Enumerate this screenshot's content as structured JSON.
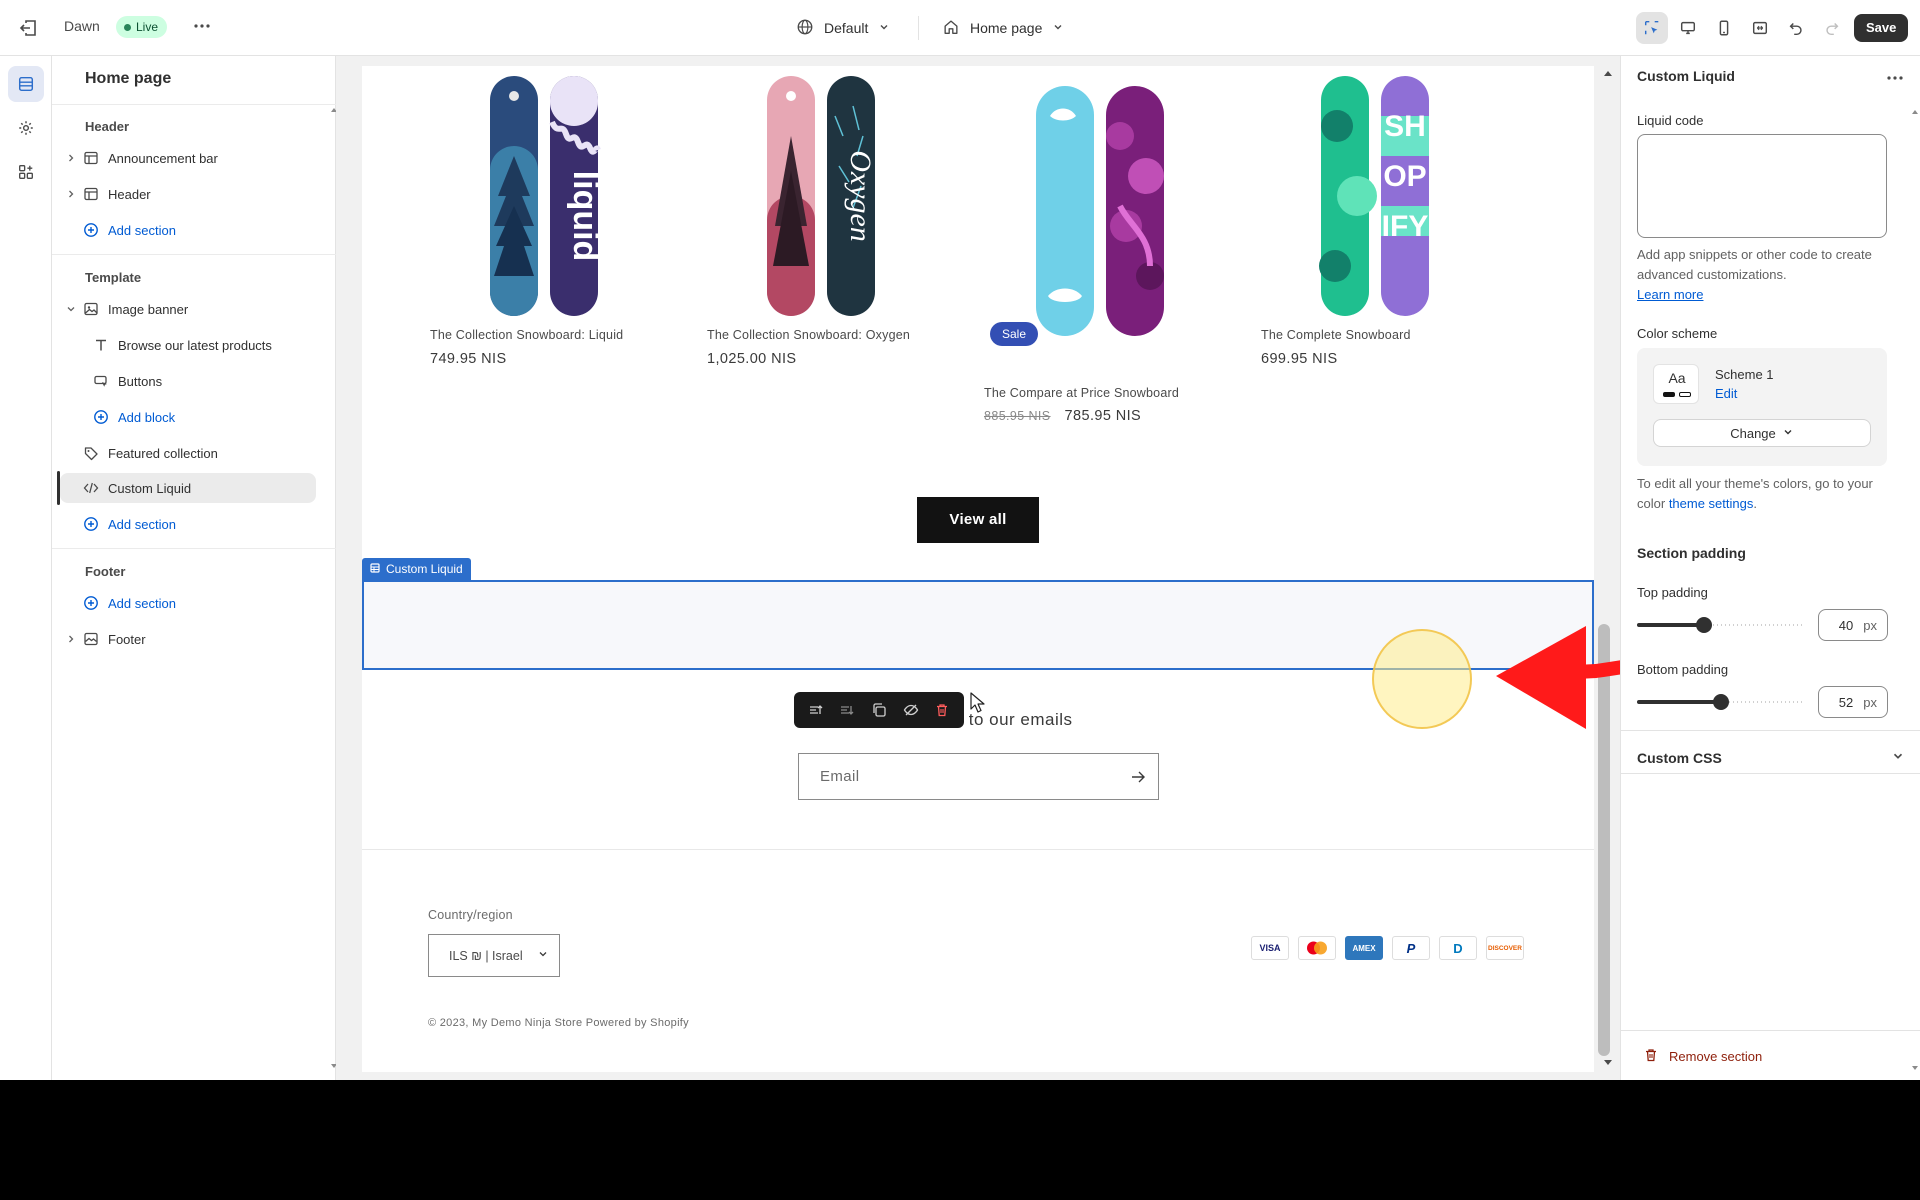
{
  "topbar": {
    "theme_name": "Dawn",
    "live_badge": "Live",
    "locale": "Default",
    "page": "Home page",
    "save_label": "Save"
  },
  "sidebar": {
    "title": "Home page",
    "header_group": "Header",
    "header_items": [
      "Announcement bar",
      "Header"
    ],
    "add_section": "Add section",
    "template_group": "Template",
    "image_banner": "Image banner",
    "image_banner_blocks": [
      "Browse our latest products",
      "Buttons"
    ],
    "add_block": "Add block",
    "featured_collection": "Featured collection",
    "custom_liquid": "Custom Liquid",
    "footer_group": "Footer",
    "footer_item": "Footer"
  },
  "preview": {
    "products": [
      {
        "name": "The Collection Snowboard: Liquid",
        "price": "749.95 NIS"
      },
      {
        "name": "The Collection Snowboard: Oxygen",
        "price": "1,025.00 NIS"
      },
      {
        "name": "The Compare at Price Snowboard",
        "compare_price": "885.95 NIS",
        "price": "785.95 NIS",
        "badge": "Sale"
      },
      {
        "name": "The Complete Snowboard",
        "price": "699.95 NIS"
      }
    ],
    "view_all": "View all",
    "section_tag": "Custom Liquid",
    "subscribe_heading": "Subscribe to our emails",
    "email_placeholder": "Email",
    "country_label": "Country/region",
    "country_value": "ILS ₪ | Israel",
    "payments": [
      "Visa",
      "Mastercard",
      "American Express",
      "PayPal",
      "Diners Club",
      "Discover"
    ],
    "payment_short": [
      "VISA",
      "MC",
      "AMEX",
      "P",
      "D",
      "DISCOVER"
    ],
    "copyright": "© 2023, My Demo Ninja Store Powered by Shopify"
  },
  "panel": {
    "title": "Custom Liquid",
    "liquid_code_label": "Liquid code",
    "liquid_help": "Add app snippets or other code to create advanced customizations.",
    "learn_more": "Learn more",
    "color_scheme_label": "Color scheme",
    "scheme_aa": "Aa",
    "scheme_name": "Scheme 1",
    "scheme_edit": "Edit",
    "scheme_change": "Change",
    "colors_help_prefix": "To edit all your theme's colors, go to your color",
    "colors_help_link": "theme settings",
    "section_padding": "Section padding",
    "top_padding_label": "Top padding",
    "top_padding_value": "40",
    "bottom_padding_label": "Bottom padding",
    "bottom_padding_value": "52",
    "unit": "px",
    "custom_css": "Custom CSS",
    "remove_section": "Remove section"
  },
  "colors": {
    "accent_blue": "#2c6ecb",
    "sale_badge": "#334fb4",
    "live_badge_bg": "#cdfee1",
    "annotation_red": "#ff1a1a"
  }
}
